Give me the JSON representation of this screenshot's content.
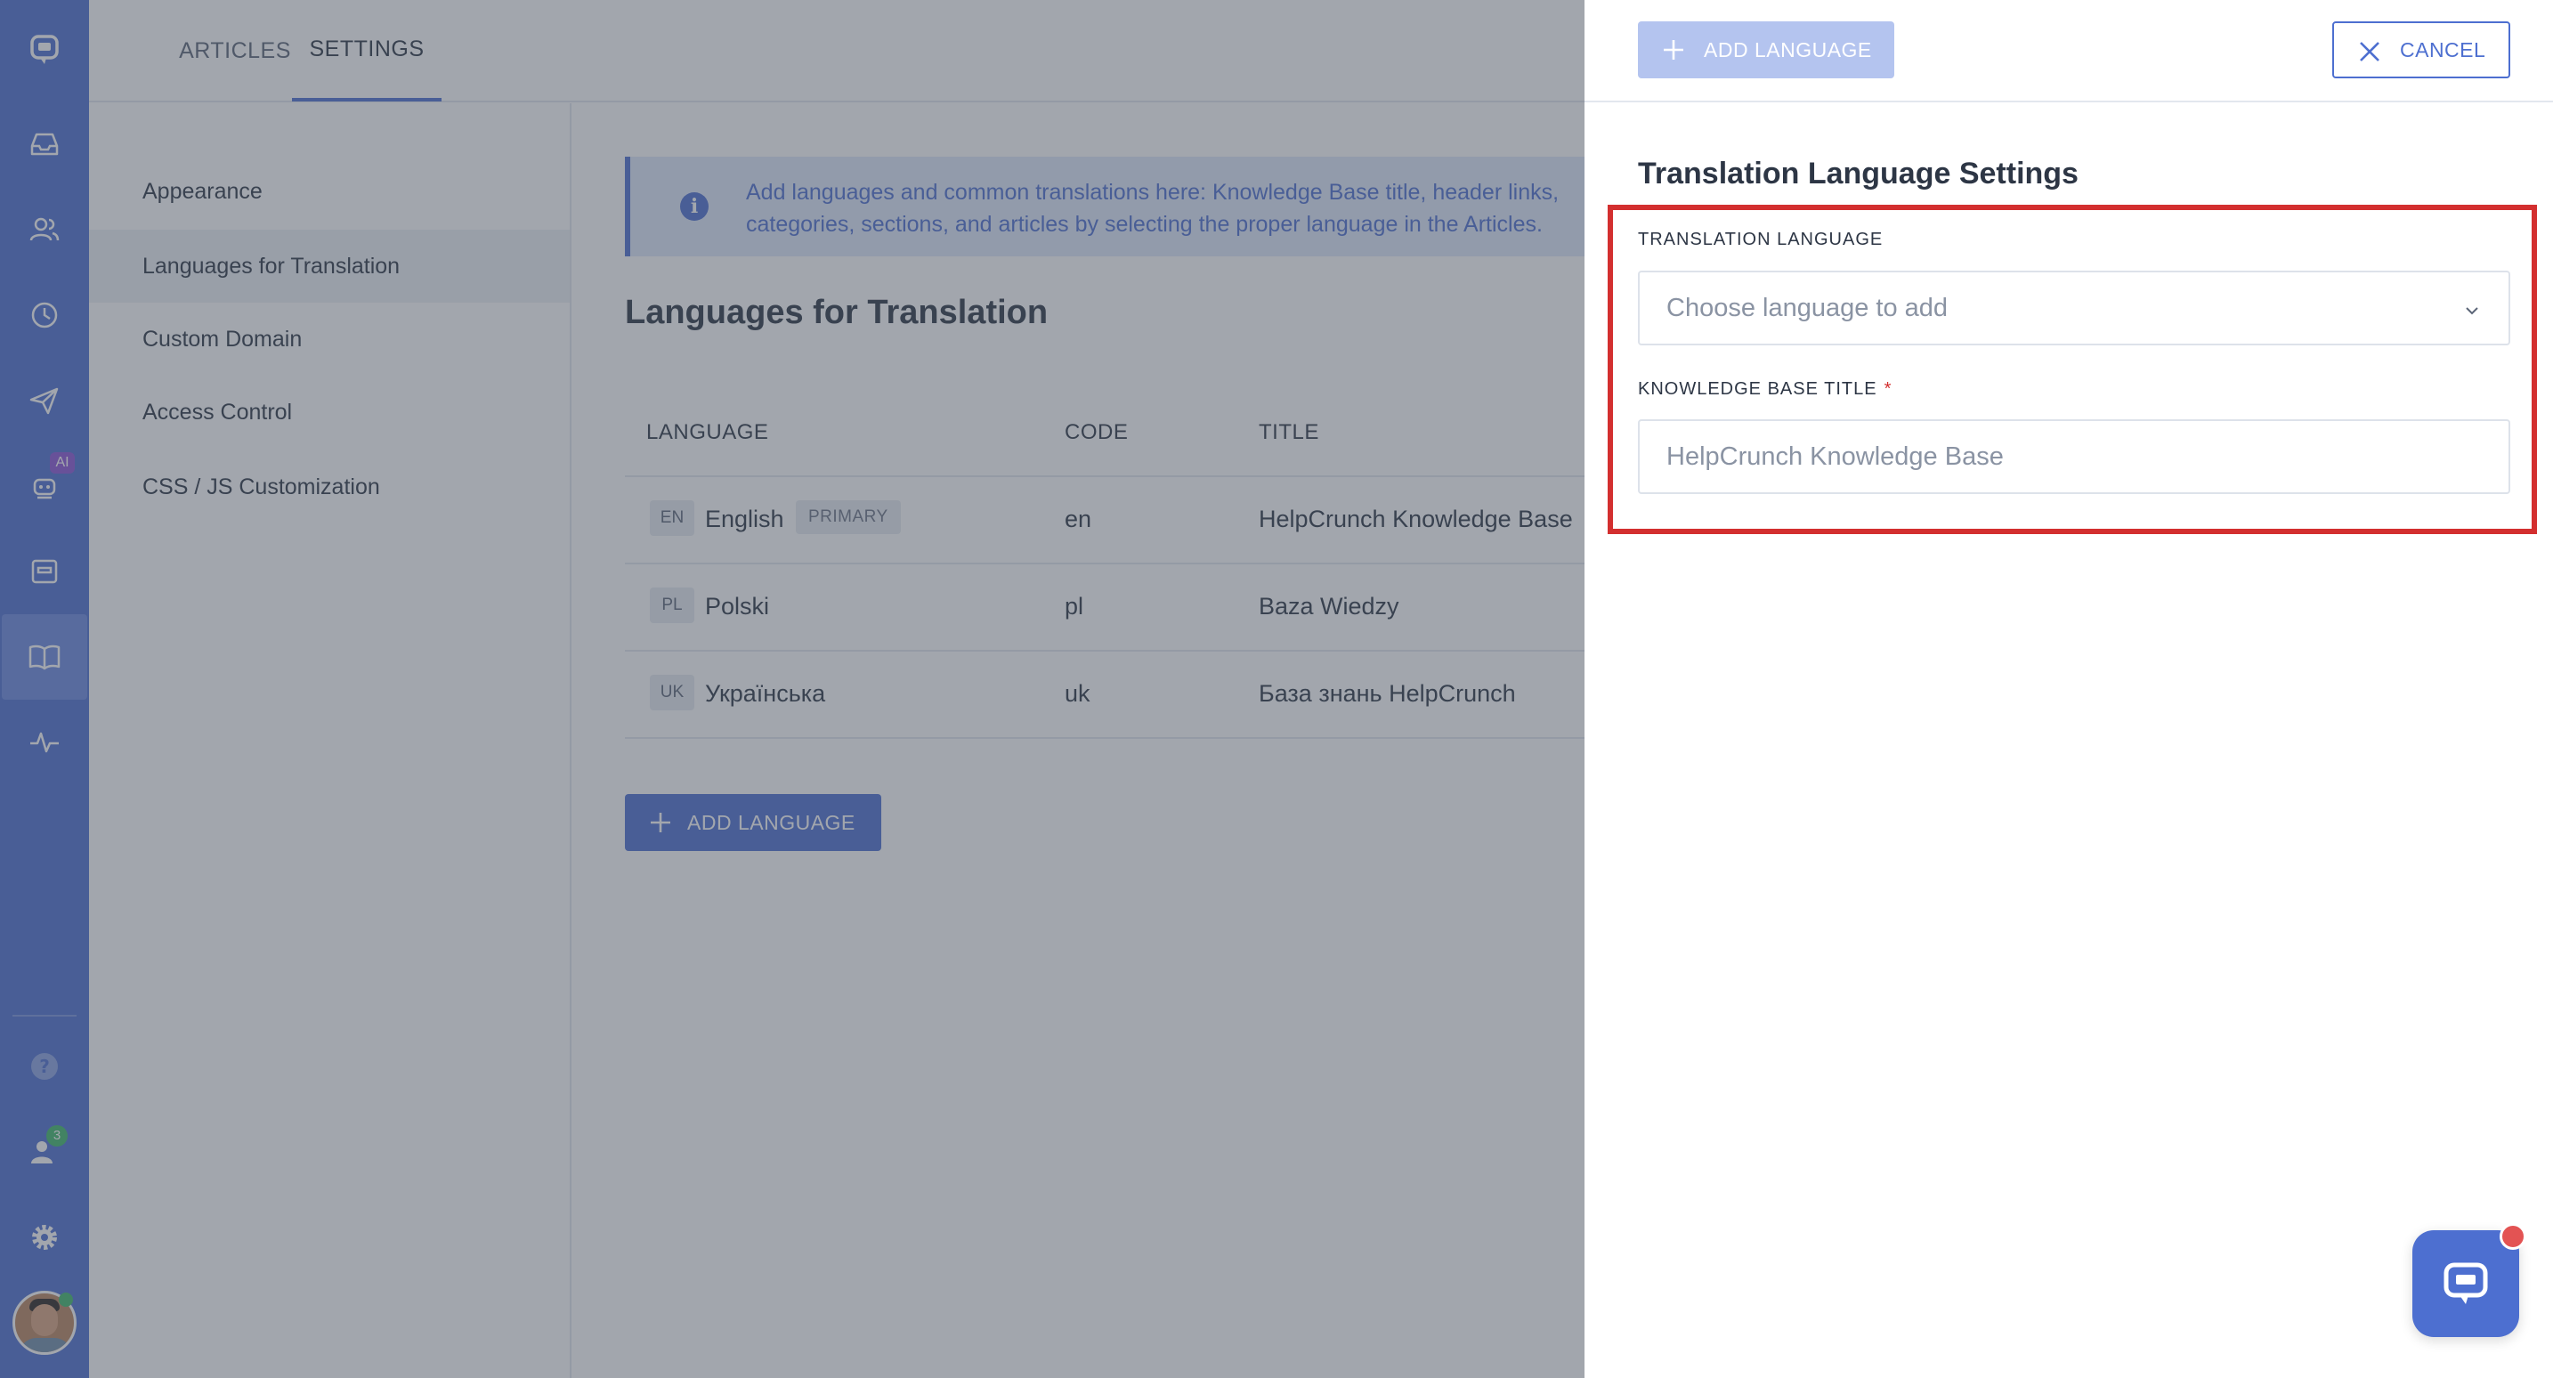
{
  "top_tabs": [
    {
      "label": "ARTICLES"
    },
    {
      "label": "SETTINGS"
    }
  ],
  "sidebar": {
    "items": [
      {
        "label": "Appearance"
      },
      {
        "label": "Languages for Translation"
      },
      {
        "label": "Custom Domain"
      },
      {
        "label": "Access Control"
      },
      {
        "label": "CSS / JS Customization"
      }
    ],
    "active_index": 1
  },
  "rail": {
    "ai_badge": "AI",
    "team_badge_count": "3"
  },
  "info": {
    "text": "Add languages and common translations here: Knowledge Base title, header links, categories, sections, and articles by selecting the proper language in the Articles."
  },
  "main": {
    "section_title": "Languages for Translation",
    "columns": [
      "LANGUAGE",
      "CODE",
      "TITLE"
    ],
    "rows": [
      {
        "code_badge": "EN",
        "language": "English",
        "tag": "PRIMARY",
        "code": "en",
        "title": "HelpCrunch Knowledge Base"
      },
      {
        "code_badge": "PL",
        "language": "Polski",
        "tag": "",
        "code": "pl",
        "title": "Baza Wiedzy"
      },
      {
        "code_badge": "UK",
        "language": "Українська",
        "tag": "",
        "code": "uk",
        "title": "База знань HelpCrunch"
      }
    ],
    "add_button": "ADD LANGUAGE"
  },
  "drawer": {
    "add_button": "ADD LANGUAGE",
    "cancel_button": "CANCEL",
    "title": "Translation Language Settings",
    "translation_language_label": "TRANSLATION LANGUAGE",
    "translation_language_placeholder": "Choose language to add",
    "kb_title_label": "KNOWLEDGE BASE TITLE",
    "kb_title_required": "*",
    "kb_title_placeholder": "HelpCrunch Knowledge Base"
  },
  "colors": {
    "accent": "#4d6fd0",
    "highlight": "#d32f2f",
    "online": "#3fb86b"
  },
  "icons": [
    "chat-logo-icon",
    "inbox-icon",
    "contacts-icon",
    "history-icon",
    "send-icon",
    "ai-bot-icon",
    "tickets-icon",
    "knowledge-base-icon",
    "activity-icon",
    "help-icon",
    "team-icon",
    "settings-gear-icon",
    "info-icon",
    "plus-icon",
    "close-icon",
    "chevron-down-icon",
    "chat-widget-icon"
  ]
}
